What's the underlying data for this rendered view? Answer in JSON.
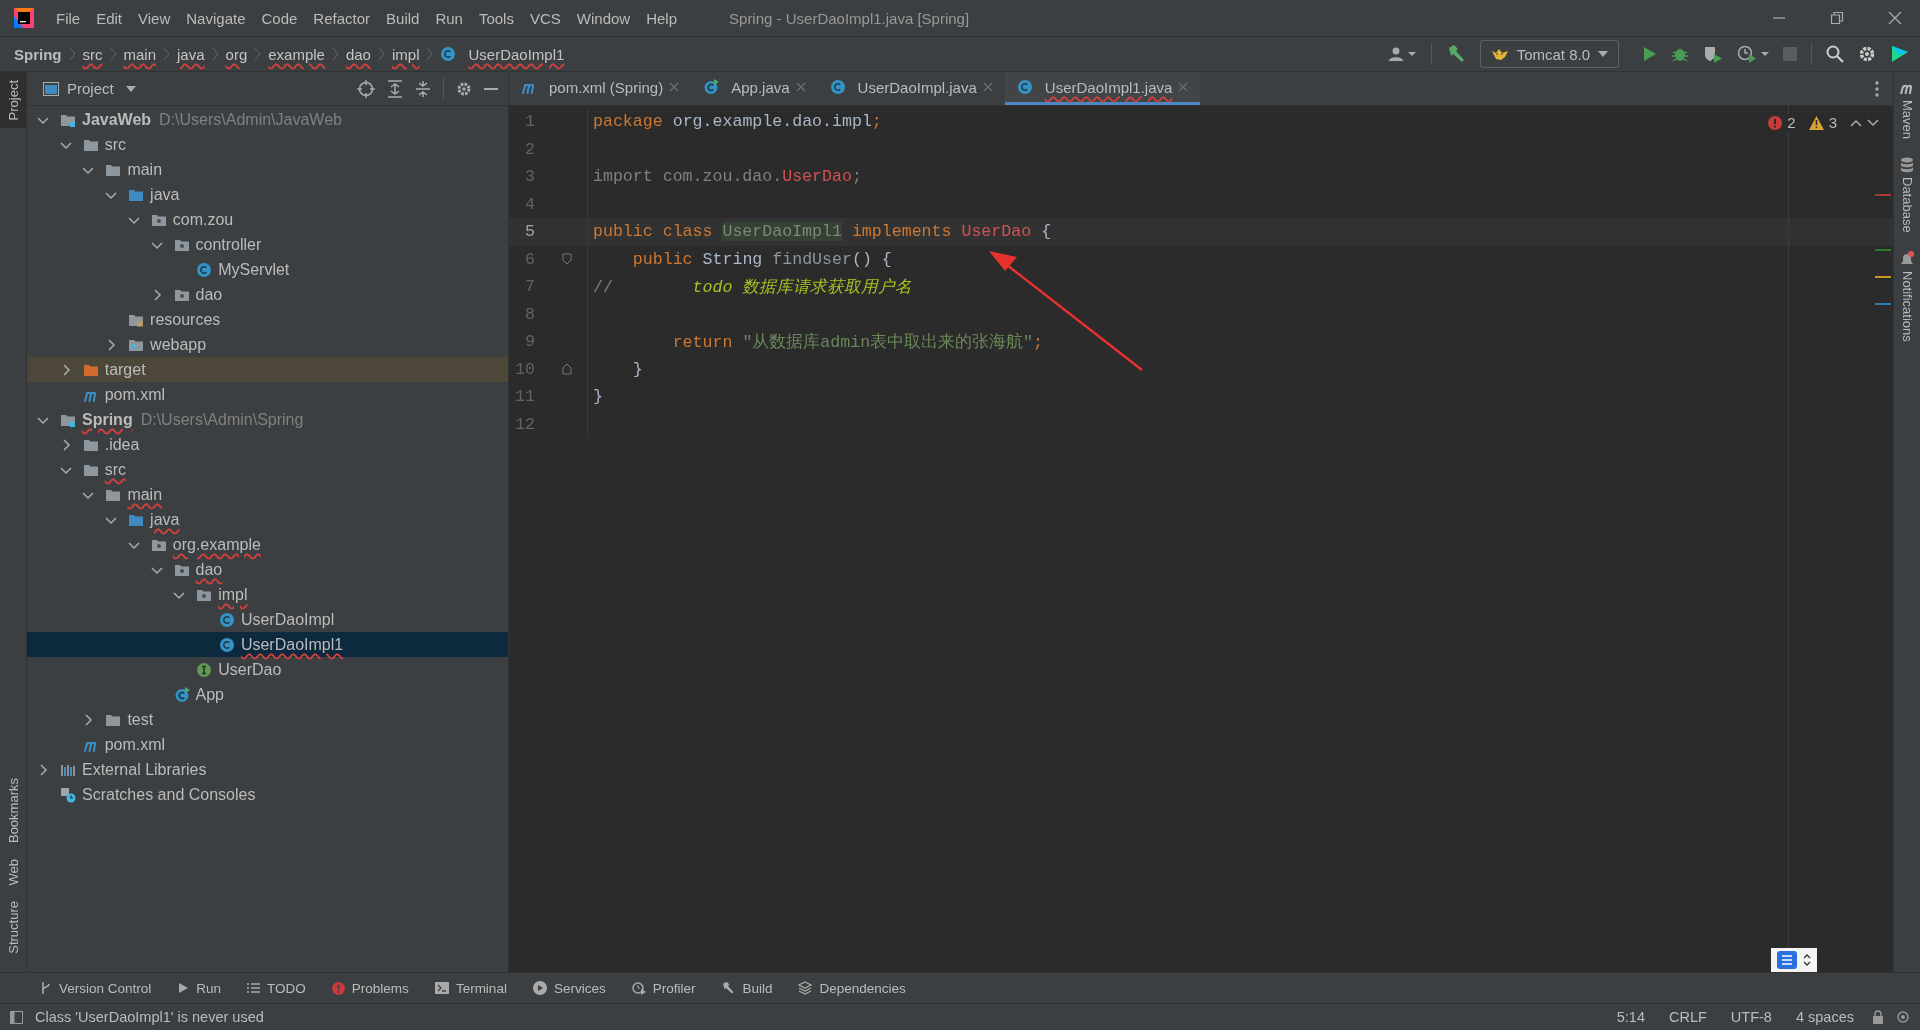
{
  "title_bar": {
    "menu": [
      "File",
      "Edit",
      "View",
      "Navigate",
      "Code",
      "Refactor",
      "Build",
      "Run",
      "Tools",
      "VCS",
      "Window",
      "Help"
    ],
    "title": "Spring - UserDaoImpl1.java [Spring]"
  },
  "breadcrumbs": [
    {
      "label": "Spring",
      "kind": "project",
      "error": false
    },
    {
      "label": "src",
      "kind": "folder",
      "error": true
    },
    {
      "label": "main",
      "kind": "folder",
      "error": true
    },
    {
      "label": "java",
      "kind": "folder",
      "error": true
    },
    {
      "label": "org",
      "kind": "folder",
      "error": true
    },
    {
      "label": "example",
      "kind": "folder",
      "error": true
    },
    {
      "label": "dao",
      "kind": "folder",
      "error": true
    },
    {
      "label": "impl",
      "kind": "folder",
      "error": true
    },
    {
      "label": "UserDaoImpl1",
      "kind": "class",
      "error": true
    }
  ],
  "toolbar": {
    "run_config": "Tomcat 8.0"
  },
  "left_strip": [
    {
      "label": "Project",
      "selected": true
    },
    {
      "label": "Bookmarks",
      "selected": false
    },
    {
      "label": "Web",
      "selected": false
    },
    {
      "label": "Structure",
      "selected": false
    }
  ],
  "project_panel": {
    "title": "Project",
    "tree": [
      {
        "label": "JavaWeb",
        "path": "D:\\Users\\Admin\\JavaWeb",
        "kind": "module",
        "expanded": true,
        "selected": false,
        "error": false,
        "children": [
          {
            "label": "src",
            "kind": "folder",
            "expanded": true,
            "selected": false,
            "error": false,
            "children": [
              {
                "label": "main",
                "kind": "folder",
                "expanded": true,
                "selected": false,
                "error": false,
                "children": [
                  {
                    "label": "java",
                    "kind": "source",
                    "expanded": true,
                    "selected": false,
                    "error": false,
                    "children": [
                      {
                        "label": "com.zou",
                        "kind": "package",
                        "expanded": true,
                        "selected": false,
                        "error": false,
                        "children": [
                          {
                            "label": "controller",
                            "kind": "package",
                            "expanded": true,
                            "selected": false,
                            "error": false,
                            "children": [
                              {
                                "label": "MyServlet",
                                "kind": "class",
                                "selected": false,
                                "error": false
                              }
                            ]
                          },
                          {
                            "label": "dao",
                            "kind": "package",
                            "expanded": false,
                            "selected": false,
                            "error": false
                          }
                        ]
                      }
                    ]
                  },
                  {
                    "label": "resources",
                    "kind": "resources",
                    "selected": false,
                    "error": false
                  },
                  {
                    "label": "webapp",
                    "kind": "web",
                    "expanded": false,
                    "selected": false,
                    "error": false
                  }
                ]
              }
            ]
          },
          {
            "label": "target",
            "kind": "excluded",
            "expanded": false,
            "selected": false,
            "error": false
          },
          {
            "label": "pom.xml",
            "kind": "maven",
            "selected": false,
            "error": false
          }
        ]
      },
      {
        "label": "Spring",
        "path": "D:\\Users\\Admin\\Spring",
        "kind": "module",
        "expanded": true,
        "selected": false,
        "error": true,
        "children": [
          {
            "label": ".idea",
            "kind": "folder",
            "expanded": false,
            "selected": false,
            "error": false
          },
          {
            "label": "src",
            "kind": "folder",
            "expanded": true,
            "selected": false,
            "error": true,
            "children": [
              {
                "label": "main",
                "kind": "folder",
                "expanded": true,
                "selected": false,
                "error": true,
                "children": [
                  {
                    "label": "java",
                    "kind": "source",
                    "expanded": true,
                    "selected": false,
                    "error": true,
                    "children": [
                      {
                        "label": "org.example",
                        "kind": "package",
                        "expanded": true,
                        "selected": false,
                        "error": true,
                        "children": [
                          {
                            "label": "dao",
                            "kind": "package",
                            "expanded": true,
                            "selected": false,
                            "error": true,
                            "children": [
                              {
                                "label": "impl",
                                "kind": "package",
                                "expanded": true,
                                "selected": false,
                                "error": true,
                                "children": [
                                  {
                                    "label": "UserDaoImpl",
                                    "kind": "class",
                                    "selected": false,
                                    "error": false
                                  },
                                  {
                                    "label": "UserDaoImpl1",
                                    "kind": "class",
                                    "selected": true,
                                    "error": true
                                  }
                                ]
                              },
                              {
                                "label": "UserDao",
                                "kind": "interface",
                                "selected": false,
                                "error": false
                              }
                            ]
                          },
                          {
                            "label": "App",
                            "kind": "runnable",
                            "selected": false,
                            "error": false
                          }
                        ]
                      }
                    ]
                  }
                ]
              },
              {
                "label": "test",
                "kind": "folder",
                "expanded": false,
                "selected": false,
                "error": false
              }
            ]
          },
          {
            "label": "pom.xml",
            "kind": "maven",
            "selected": false,
            "error": false
          }
        ]
      },
      {
        "label": "External Libraries",
        "kind": "libraries",
        "expanded": false,
        "selected": false,
        "error": false
      },
      {
        "label": "Scratches and Consoles",
        "kind": "scratches",
        "selected": false,
        "error": false
      }
    ]
  },
  "tabs": [
    {
      "label": "pom.xml (Spring)",
      "kind": "maven",
      "selected": false,
      "error": false
    },
    {
      "label": "App.java",
      "kind": "runnable",
      "selected": false,
      "error": false
    },
    {
      "label": "UserDaoImpl.java",
      "kind": "class",
      "selected": false,
      "error": false
    },
    {
      "label": "UserDaoImpl1.java",
      "kind": "class",
      "selected": true,
      "error": true
    }
  ],
  "editor": {
    "errors": "2",
    "warnings": "3",
    "lines": [
      {
        "number": "1",
        "kind": "code",
        "current": false,
        "tokens": [
          {
            "kind": "keyword",
            "text": "package"
          },
          {
            "kind": "plain",
            "text": " org.example.dao.impl"
          },
          {
            "kind": "keyword",
            "text": ";"
          }
        ]
      },
      {
        "number": "2",
        "kind": "code",
        "current": false
      },
      {
        "number": "3",
        "kind": "code",
        "current": false,
        "tokens": [
          {
            "kind": "unused",
            "text": "import com.zou.dao."
          },
          {
            "kind": "error",
            "text": "UserDao"
          },
          {
            "kind": "unused",
            "text": ";"
          }
        ]
      },
      {
        "number": "4",
        "kind": "code",
        "current": false
      },
      {
        "number": "5",
        "kind": "code",
        "current": true,
        "tokens": [
          {
            "kind": "keyword",
            "text": "public class "
          },
          {
            "kind": "highlighted",
            "text": "UserDaoImpl1"
          },
          {
            "kind": "keyword",
            "text": " implements "
          },
          {
            "kind": "error",
            "text": "UserDao"
          },
          {
            "kind": "plain",
            "text": " {"
          }
        ]
      },
      {
        "number": "6",
        "kind": "fold-start",
        "current": false,
        "tokens": [
          {
            "kind": "keyword",
            "text": "    public "
          },
          {
            "kind": "plain",
            "text": "String "
          },
          {
            "kind": "unused-method",
            "text": "findUser"
          },
          {
            "kind": "plain",
            "text": "() {"
          }
        ]
      },
      {
        "number": "7",
        "kind": "code",
        "current": false,
        "tokens": [
          {
            "kind": "comment",
            "text": "//"
          },
          {
            "kind": "todo",
            "text": "        todo 数据库请求获取用户名"
          }
        ]
      },
      {
        "number": "8",
        "kind": "code",
        "current": false
      },
      {
        "number": "9",
        "kind": "code",
        "current": false,
        "tokens": [
          {
            "kind": "keyword",
            "text": "        return "
          },
          {
            "kind": "string",
            "text": "\"从数据库admin表中取出来的张海航\""
          },
          {
            "kind": "keyword",
            "text": ";"
          }
        ]
      },
      {
        "number": "10",
        "kind": "fold-end",
        "current": false,
        "tokens": [
          {
            "kind": "plain",
            "text": "    }"
          }
        ]
      },
      {
        "number": "11",
        "kind": "code",
        "current": false,
        "tokens": [
          {
            "kind": "plain",
            "text": "}"
          }
        ]
      },
      {
        "number": "12",
        "kind": "code",
        "current": false
      }
    ]
  },
  "right_strip": [
    {
      "label": "Maven"
    },
    {
      "label": "Database"
    },
    {
      "label": "Notifications"
    }
  ],
  "tool_windows": [
    "Version Control",
    "Run",
    "TODO",
    "Problems",
    "Terminal",
    "Services",
    "Profiler",
    "Build",
    "Dependencies"
  ],
  "status_bar": {
    "message": "Class 'UserDaoImpl1' is never used",
    "position": "5:14",
    "line_separator": "CRLF",
    "encoding": "UTF-8",
    "indent": "4 spaces"
  }
}
